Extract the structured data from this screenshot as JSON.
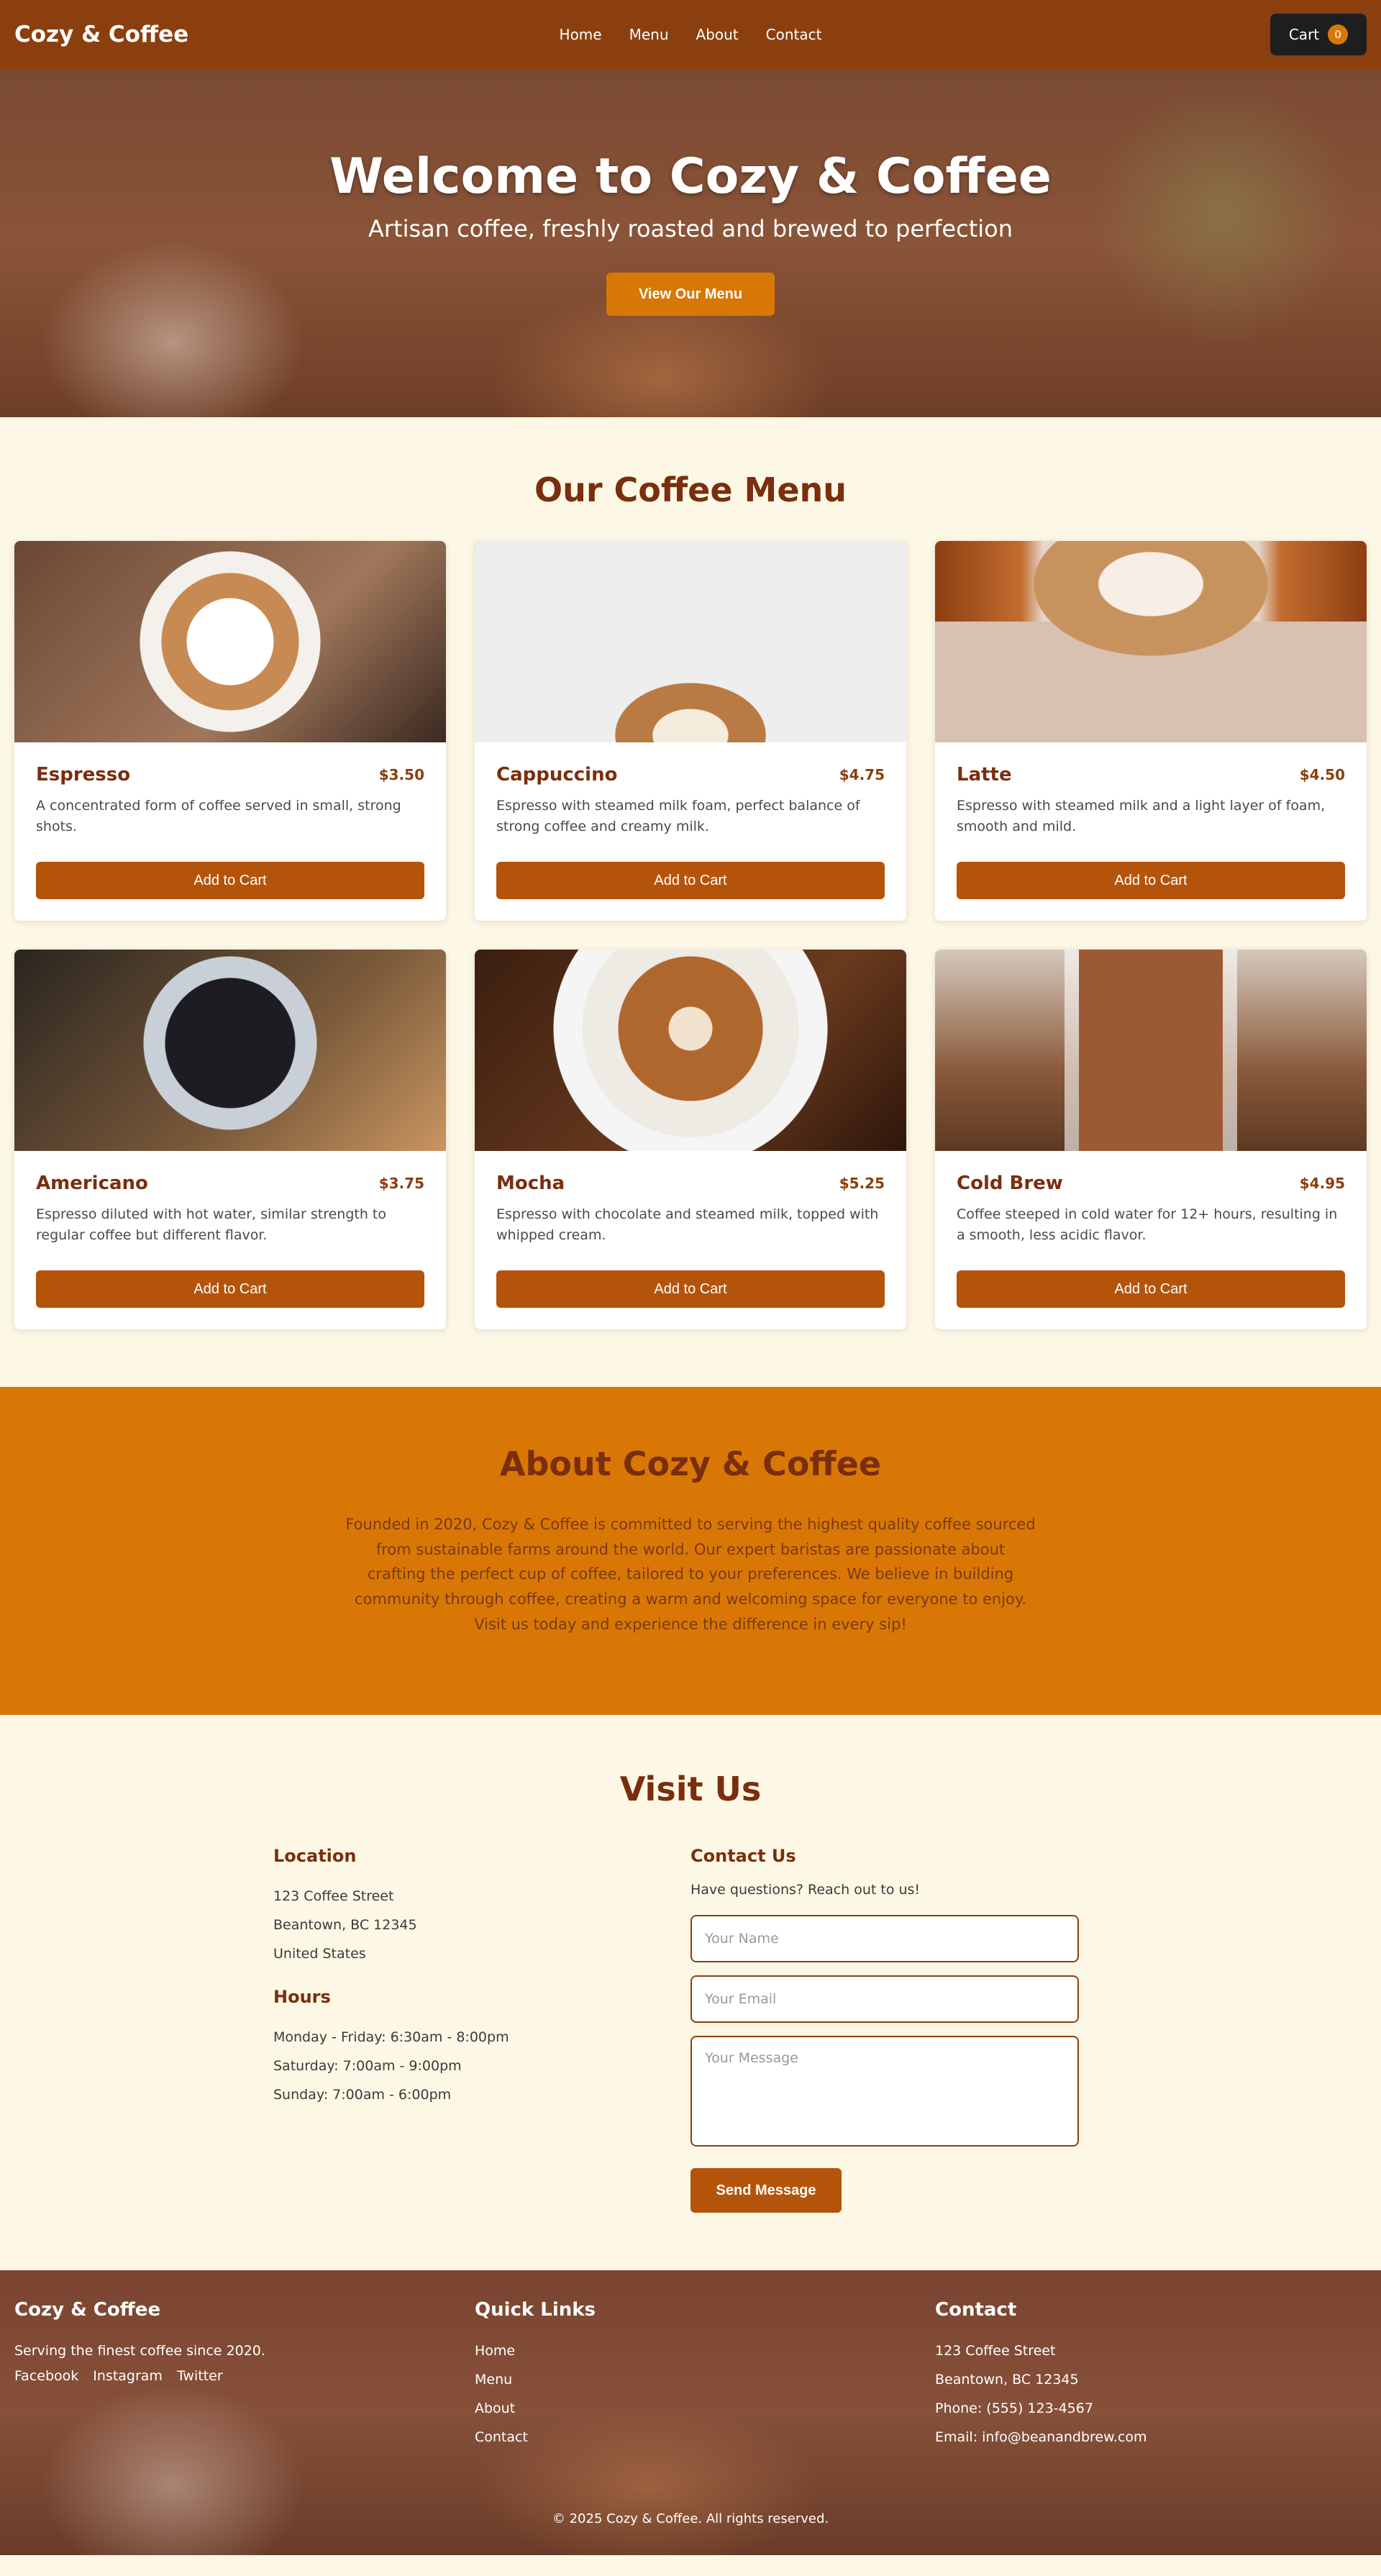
{
  "nav": {
    "brand": "Cozy & Coffee",
    "links": [
      "Home",
      "Menu",
      "About",
      "Contact"
    ],
    "cart_label": "Cart",
    "cart_count": "0"
  },
  "hero": {
    "title": "Welcome to Cozy & Coffee",
    "subtitle": "Artisan coffee, freshly roasted and brewed to perfection",
    "button": "View Our Menu"
  },
  "menu": {
    "title": "Our Coffee Menu",
    "add_label": "Add to Cart",
    "items": [
      {
        "name": "Espresso",
        "price": "$3.50",
        "desc": "A concentrated form of coffee served in small, strong shots."
      },
      {
        "name": "Cappuccino",
        "price": "$4.75",
        "desc": "Espresso with steamed milk foam, perfect balance of strong coffee and creamy milk."
      },
      {
        "name": "Latte",
        "price": "$4.50",
        "desc": "Espresso with steamed milk and a light layer of foam, smooth and mild."
      },
      {
        "name": "Americano",
        "price": "$3.75",
        "desc": "Espresso diluted with hot water, similar strength to regular coffee but different flavor."
      },
      {
        "name": "Mocha",
        "price": "$5.25",
        "desc": "Espresso with chocolate and steamed milk, topped with whipped cream."
      },
      {
        "name": "Cold Brew",
        "price": "$4.95",
        "desc": "Coffee steeped in cold water for 12+ hours, resulting in a smooth, less acidic flavor."
      }
    ]
  },
  "about": {
    "title": "About Cozy & Coffee",
    "text": "Founded in 2020, Cozy & Coffee is committed to serving the highest quality coffee sourced from sustainable farms around the world. Our expert baristas are passionate about crafting the perfect cup of coffee, tailored to your preferences. We believe in building community through coffee, creating a warm and welcoming space for everyone to enjoy. Visit us today and experience the difference in every sip!"
  },
  "visit": {
    "title": "Visit Us",
    "location_title": "Location",
    "address": [
      "123 Coffee Street",
      "Beantown, BC 12345",
      "United States"
    ],
    "hours_title": "Hours",
    "hours": [
      "Monday - Friday: 6:30am - 8:00pm",
      "Saturday: 7:00am - 9:00pm",
      "Sunday: 7:00am - 6:00pm"
    ],
    "contact_title": "Contact Us",
    "contact_intro": "Have questions? Reach out to us!",
    "name_placeholder": "Your Name",
    "email_placeholder": "Your Email",
    "message_placeholder": "Your Message",
    "send_label": "Send Message"
  },
  "footer": {
    "brand": "Cozy & Coffee",
    "tagline": "Serving the finest coffee since 2020.",
    "social": [
      "Facebook",
      "Instagram",
      "Twitter"
    ],
    "links_title": "Quick Links",
    "links": [
      "Home",
      "Menu",
      "About",
      "Contact"
    ],
    "contact_title": "Contact",
    "contact": [
      "123 Coffee Street",
      "Beantown, BC 12345",
      "Phone: (555) 123-4567",
      "Email: info@beanandbrew.com"
    ],
    "copyright": "© 2025 Cozy & Coffee. All rights reserved."
  }
}
